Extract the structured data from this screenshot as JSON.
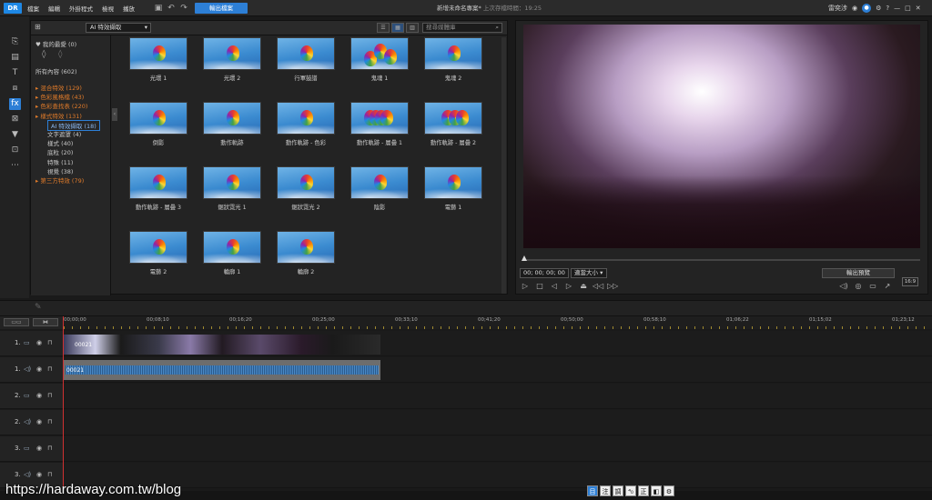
{
  "app": {
    "logo": "DR",
    "project_title": "新增未命名專案*",
    "saved_status": "上次存檔時間：19:25"
  },
  "menu": [
    "檔案",
    "編輯",
    "外掛程式",
    "檢視",
    "播放"
  ],
  "toolbar": {
    "export_label": "輸出檔案",
    "user_name": "雷奕涉"
  },
  "library": {
    "filter": "AI 特效擷取",
    "search_placeholder": "搜尋媒體庫",
    "tree": {
      "favorites": "我的最愛 (0)",
      "all": "所有內容 (602)",
      "items": [
        {
          "label": "混合特效 (129)",
          "indent": 0,
          "orange": true
        },
        {
          "label": "色彩風格檔 (43)",
          "indent": 0,
          "orange": true
        },
        {
          "label": "色彩查找表 (220)",
          "indent": 0,
          "orange": true
        },
        {
          "label": "樣式特效 (131)",
          "indent": 0,
          "orange": true
        },
        {
          "label": "AI 特效擷取 (18)",
          "indent": 1,
          "orange": false,
          "selected": true
        },
        {
          "label": "文字遮罩 (4)",
          "indent": 1,
          "orange": false
        },
        {
          "label": "樣式 (40)",
          "indent": 1,
          "orange": false
        },
        {
          "label": "底粒 (20)",
          "indent": 1,
          "orange": false
        },
        {
          "label": "特殊 (11)",
          "indent": 1,
          "orange": false
        },
        {
          "label": "視覺 (38)",
          "indent": 1,
          "orange": false
        },
        {
          "label": "第三方特效 (79)",
          "indent": 0,
          "orange": true
        }
      ]
    },
    "effects": [
      "光環 1",
      "光環 2",
      "行軍鼓譜",
      "鬼魂 1",
      "鬼魂 2",
      "倒影",
      "動作軌跡",
      "動作軌跡 - 色彩",
      "動作軌跡 - 層疊 1",
      "動作軌跡 - 層疊 2",
      "動作軌跡 - 層疊 3",
      "鋸狀霓光 1",
      "鋸狀霓光 2",
      "陰影",
      "電藝 1",
      "電藝 2",
      "輪廓 1",
      "輪廓 2"
    ]
  },
  "preview": {
    "timecode": "00; 00; 00; 00",
    "fit": "適當大小",
    "output_preview": "輸出預覽",
    "aspect": "16:9"
  },
  "timeline": {
    "ticks": [
      "00;00;00",
      "00;08;10",
      "00;16;20",
      "00;25;00",
      "00;33;10",
      "00;41;20",
      "00;50;00",
      "00;58;10",
      "01;06;22",
      "01;15;02",
      "01;23;12"
    ],
    "tracks": [
      {
        "num": "1."
      },
      {
        "num": "1."
      },
      {
        "num": "2."
      },
      {
        "num": "2."
      },
      {
        "num": "3."
      },
      {
        "num": "3."
      }
    ],
    "video_clip": "00021",
    "audio_clip": "00021"
  },
  "watermark": "https://hardaway.com.tw/blog",
  "bottom_tools": [
    "目",
    "注",
    "調",
    "⁴₀",
    "正",
    "◧",
    "⚙"
  ],
  "colors": {
    "accent": "#2d7fd6",
    "orange": "#e07b2a",
    "playhead": "#d03030"
  }
}
